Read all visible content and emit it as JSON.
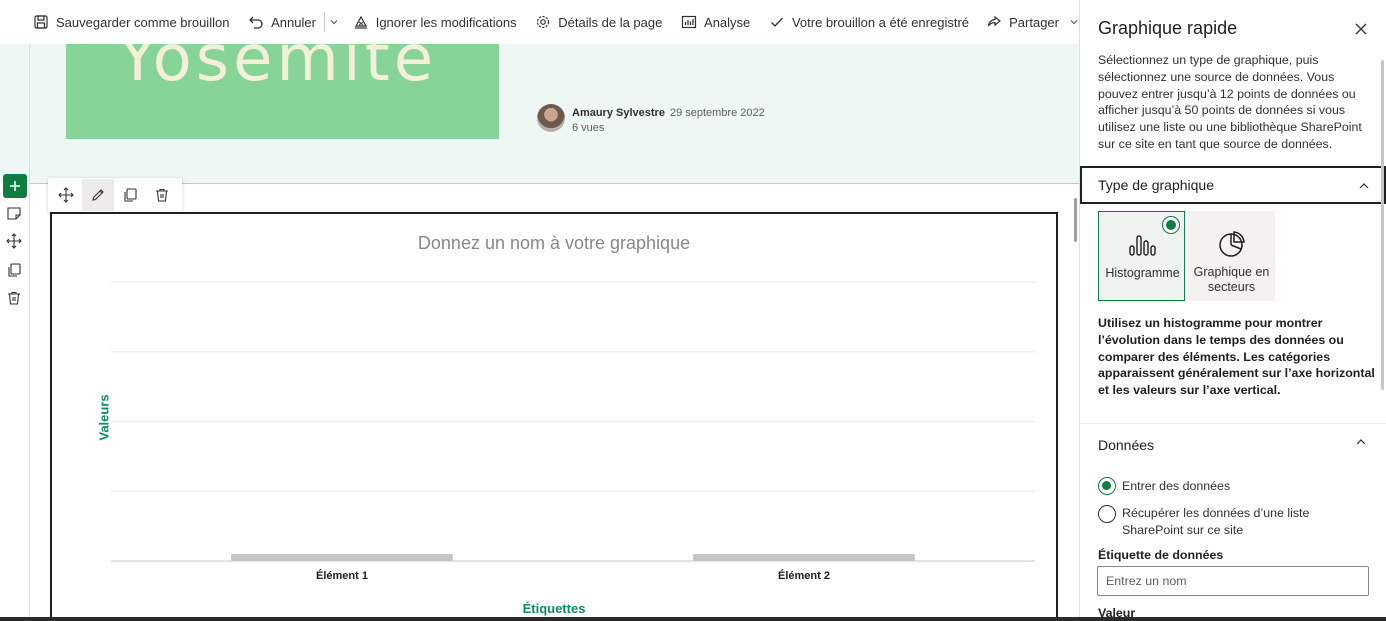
{
  "toolbar": {
    "save_draft": "Sauvegarder comme brouillon",
    "undo": "Annuler",
    "discard": "Ignorer les modifications",
    "page_details": "Détails de la page",
    "analytics": "Analyse",
    "draft_saved": "Votre brouillon a été enregistré",
    "share": "Partager"
  },
  "hero": {
    "banner_text": "Yosemite",
    "author_name": "Amaury Sylvestre",
    "date": "29 septembre 2022",
    "views": "6 vues"
  },
  "chart": {
    "title_placeholder": "Donnez un nom à votre graphique",
    "y_axis_label": "Valeurs",
    "x_axis_label": "Étiquettes"
  },
  "chart_data": {
    "type": "bar",
    "title": "",
    "xlabel": "Étiquettes",
    "ylabel": "Valeurs",
    "categories": [
      "Élément 1",
      "Élément 2"
    ],
    "values": [
      0,
      0
    ],
    "ylim": [
      0,
      4
    ],
    "grid": true,
    "bar_color": "#c8c6c4"
  },
  "panel": {
    "title": "Graphique rapide",
    "description": "Sélectionnez un type de graphique, puis sélectionnez une source de données. Vous pouvez entrer jusqu’à 12 points de données ou afficher jusqu’à 50 points de données si vous utilisez une liste ou une bibliothèque SharePoint sur ce site en tant que source de données.",
    "chart_type_header": "Type de graphique",
    "chart_types": [
      {
        "label": "Histogramme",
        "selected": true,
        "icon": "column-chart-icon"
      },
      {
        "label": "Graphique en secteurs",
        "selected": false,
        "icon": "pie-chart-icon"
      }
    ],
    "chart_type_help": "Utilisez un histogramme pour montrer l’évolution dans le temps des données ou comparer des éléments. Les catégories apparaissent généralement sur l’axe horizontal et les valeurs sur l’axe vertical.",
    "data_header": "Données",
    "data_options": [
      {
        "label": "Entrer des données",
        "selected": true
      },
      {
        "label": "Récupérer les données d’une liste SharePoint sur ce site",
        "selected": false
      }
    ],
    "data_label_title": "Étiquette de données",
    "data_label_placeholder": "Entrez un nom",
    "value_title": "Valeur"
  },
  "colors": {
    "accent": "#107c41",
    "axis_label": "#0f8a5f",
    "banner": "#88d498"
  }
}
